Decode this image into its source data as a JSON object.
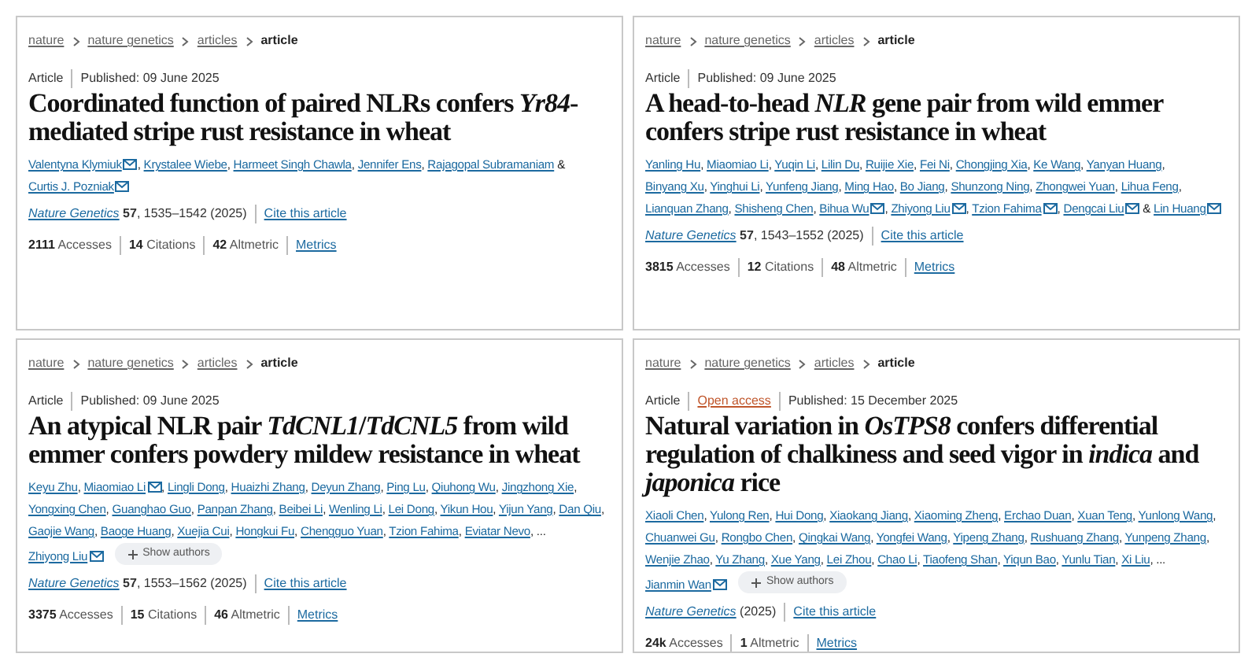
{
  "cards": [
    {
      "breadcrumb": [
        {
          "label": "nature",
          "current": false
        },
        {
          "label": "nature genetics",
          "current": false
        },
        {
          "label": "articles",
          "current": false
        },
        {
          "label": "article",
          "current": true
        }
      ],
      "meta": [
        {
          "kind": "type",
          "text": "Article"
        },
        {
          "kind": "date",
          "text": "Published: 09 June 2025"
        }
      ],
      "title": "Coordinated function of paired NLRs confers *Yr84*-mediated stripe rust resistance in wheat",
      "authors": [
        {
          "name": "Valentyna Klymiuk",
          "email": true,
          "after": ","
        },
        {
          "name": "Krystalee Wiebe",
          "email": false,
          "after": ","
        },
        {
          "name": "Harmeet Singh Chawla",
          "email": false,
          "after": ","
        },
        {
          "name": "Jennifer Ens",
          "email": false,
          "after": ","
        },
        {
          "name": "Rajagopal Subramaniam",
          "email": false
        },
        {
          "lead": "&",
          "name": "Curtis J. Pozniak",
          "email": true
        }
      ],
      "journal": "Nature Genetics",
      "citation": "**57**, 1535–1542 (2025)",
      "cite": "Cite this article",
      "metrics": [
        "**2111** Accesses",
        "**14** Citations",
        "**42** Altmetric"
      ],
      "metrics_link": "Metrics"
    },
    {
      "breadcrumb": [
        {
          "label": "nature",
          "current": false
        },
        {
          "label": "nature genetics",
          "current": false
        },
        {
          "label": "articles",
          "current": false
        },
        {
          "label": "article",
          "current": true
        }
      ],
      "meta": [
        {
          "kind": "type",
          "text": "Article"
        },
        {
          "kind": "date",
          "text": "Published: 09 June 2025"
        }
      ],
      "title": "A head-to-head *NLR* gene pair from wild emmer confers stripe rust resistance in wheat",
      "authors": [
        {
          "name": "Yanling Hu",
          "email": false,
          "after": ","
        },
        {
          "name": "Miaomiao Li",
          "email": false,
          "after": ","
        },
        {
          "name": "Yuqin Li",
          "email": false,
          "after": ","
        },
        {
          "name": "Lilin Du",
          "email": false,
          "after": ","
        },
        {
          "name": "Ruijie Xie",
          "email": false,
          "after": ","
        },
        {
          "name": "Fei Ni",
          "email": false,
          "after": ","
        },
        {
          "name": "Chongjing Xia",
          "email": false,
          "after": ","
        },
        {
          "name": "Ke Wang",
          "email": false,
          "after": ","
        },
        {
          "name": "Yanyan Huang",
          "email": false,
          "after": ","
        },
        {
          "name": "Binyang Xu",
          "email": false,
          "after": ","
        },
        {
          "name": "Yinghui Li",
          "email": false,
          "after": ","
        },
        {
          "name": "Yunfeng Jiang",
          "email": false,
          "after": ","
        },
        {
          "name": "Ming Hao",
          "email": false,
          "after": ","
        },
        {
          "name": "Bo Jiang",
          "email": false,
          "after": ","
        },
        {
          "name": "Shunzong Ning",
          "email": false,
          "after": ","
        },
        {
          "name": "Zhongwei Yuan",
          "email": false,
          "after": ","
        },
        {
          "name": "Lihua Feng",
          "email": false,
          "after": ","
        },
        {
          "name": "Lianquan Zhang",
          "email": false,
          "after": ","
        },
        {
          "name": "Shisheng Chen",
          "email": false,
          "after": ","
        },
        {
          "name": "Bihua Wu",
          "email": true,
          "after": ","
        },
        {
          "name": "Zhiyong Liu",
          "email": true,
          "after": ","
        },
        {
          "name": "Tzion Fahima",
          "email": true,
          "after": ","
        },
        {
          "name": "Dengcai Liu",
          "email": true,
          "after": "&"
        },
        {
          "name": "Lin Huang",
          "email": true
        }
      ],
      "journal": "Nature Genetics",
      "citation": "**57**, 1543–1552 (2025)",
      "cite": "Cite this article",
      "metrics": [
        "**3815** Accesses",
        "**12** Citations",
        "**48** Altmetric"
      ],
      "metrics_link": "Metrics"
    },
    {
      "breadcrumb": [
        {
          "label": "nature",
          "current": false
        },
        {
          "label": "nature genetics",
          "current": false
        },
        {
          "label": "articles",
          "current": false
        },
        {
          "label": "article",
          "current": true
        }
      ],
      "meta": [
        {
          "kind": "type",
          "text": "Article"
        },
        {
          "kind": "date",
          "text": "Published: 09 June 2025"
        }
      ],
      "title": "An atypical NLR pair *TdCNL1*/*TdCNL5* from wild emmer confers powdery mildew resistance in wheat",
      "authors": [
        {
          "name": "Keyu Zhu",
          "email": false,
          "after": ","
        },
        {
          "name": "Miaomiao Li",
          "email": true,
          "after": ","
        },
        {
          "name": "Lingli Dong",
          "email": false,
          "after": ","
        },
        {
          "name": "Huaizhi Zhang",
          "email": false,
          "after": ","
        },
        {
          "name": "Deyun Zhang",
          "email": false,
          "after": ","
        },
        {
          "name": "Ping Lu",
          "email": false,
          "after": ","
        },
        {
          "name": "Qiuhong Wu",
          "email": false,
          "after": ","
        },
        {
          "name": "Jingzhong Xie",
          "email": false,
          "after": ","
        },
        {
          "name": "Yongxing Chen",
          "email": false,
          "after": ","
        },
        {
          "name": "Guanghao Guo",
          "email": false,
          "after": ","
        },
        {
          "name": "Panpan Zhang",
          "email": false,
          "after": ","
        },
        {
          "name": "Beibei Li",
          "email": false,
          "after": ","
        },
        {
          "name": "Wenling Li",
          "email": false,
          "after": ","
        },
        {
          "name": "Lei Dong",
          "email": false,
          "after": ","
        },
        {
          "name": "Yikun Hou",
          "email": false,
          "after": ","
        },
        {
          "name": "Yijun Yang",
          "email": false,
          "after": ","
        },
        {
          "name": "Dan Qiu",
          "email": false,
          "after": ","
        },
        {
          "name": "Gaojie Wang",
          "email": false,
          "after": ","
        },
        {
          "name": "Baoge Huang",
          "email": false,
          "after": ","
        },
        {
          "name": "Xuejia Cui",
          "email": false,
          "after": ","
        },
        {
          "name": "Hongkui Fu",
          "email": false,
          "after": ","
        },
        {
          "name": "Chengguo Yuan",
          "email": false,
          "after": ","
        },
        {
          "name": "Tzion Fahima",
          "email": false,
          "after": ","
        },
        {
          "name": "Eviatar Nevo",
          "email": false,
          "after": ", ..."
        },
        {
          "name": "Zhiyong Liu",
          "email": true
        }
      ],
      "show_authors": "Show authors",
      "journal": "Nature Genetics",
      "citation": "**57**, 1553–1562 (2025)",
      "cite": "Cite this article",
      "metrics": [
        "**3375** Accesses",
        "**15** Citations",
        "**46** Altmetric"
      ],
      "metrics_link": "Metrics"
    },
    {
      "breadcrumb": [
        {
          "label": "nature",
          "current": false
        },
        {
          "label": "nature genetics",
          "current": false
        },
        {
          "label": "articles",
          "current": false
        },
        {
          "label": "article",
          "current": true
        }
      ],
      "meta": [
        {
          "kind": "type",
          "text": "Article"
        },
        {
          "kind": "open_access",
          "text": "Open access"
        },
        {
          "kind": "date",
          "text": "Published: 15 December 2025"
        }
      ],
      "title": "Natural variation in *OsTPS8* confers differential regulation of chalkiness and seed vigor in *indica* and *japonica* rice",
      "authors": [
        {
          "name": "Xiaoli Chen",
          "email": false,
          "after": ","
        },
        {
          "name": "Yulong Ren",
          "email": false,
          "after": ","
        },
        {
          "name": "Hui Dong",
          "email": false,
          "after": ","
        },
        {
          "name": "Xiaokang Jiang",
          "email": false,
          "after": ","
        },
        {
          "name": "Xiaoming Zheng",
          "email": false,
          "after": ","
        },
        {
          "name": "Erchao Duan",
          "email": false,
          "after": ","
        },
        {
          "name": "Xuan Teng",
          "email": false,
          "after": ","
        },
        {
          "name": "Yunlong Wang",
          "email": false,
          "after": ","
        },
        {
          "name": "Chuanwei Gu",
          "email": false,
          "after": ","
        },
        {
          "name": "Rongbo Chen",
          "email": false,
          "after": ","
        },
        {
          "name": "Qingkai Wang",
          "email": false,
          "after": ","
        },
        {
          "name": "Yongfei Wang",
          "email": false,
          "after": ","
        },
        {
          "name": "Yipeng Zhang",
          "email": false,
          "after": ","
        },
        {
          "name": "Rushuang Zhang",
          "email": false,
          "after": ","
        },
        {
          "name": "Yunpeng Zhang",
          "email": false,
          "after": ","
        },
        {
          "name": "Wenjie Zhao",
          "email": false,
          "after": ","
        },
        {
          "name": "Yu Zhang",
          "email": false,
          "after": ","
        },
        {
          "name": "Xue Yang",
          "email": false,
          "after": ","
        },
        {
          "name": "Lei Zhou",
          "email": false,
          "after": ","
        },
        {
          "name": "Chao Li",
          "email": false,
          "after": ","
        },
        {
          "name": "Tiaofeng Shan",
          "email": false,
          "after": ","
        },
        {
          "name": "Yiqun Bao",
          "email": false,
          "after": ","
        },
        {
          "name": "Yunlu Tian",
          "email": false,
          "after": ","
        },
        {
          "name": "Xi Liu",
          "email": false,
          "after": ", ..."
        },
        {
          "name": "Jianmin Wan",
          "email": true
        }
      ],
      "show_authors": "Show authors",
      "journal": "Nature Genetics",
      "citation": "(2025)",
      "cite": "Cite this article",
      "metrics": [
        "**24k** Accesses",
        "**1** Altmetric"
      ],
      "metrics_link": "Metrics"
    }
  ]
}
